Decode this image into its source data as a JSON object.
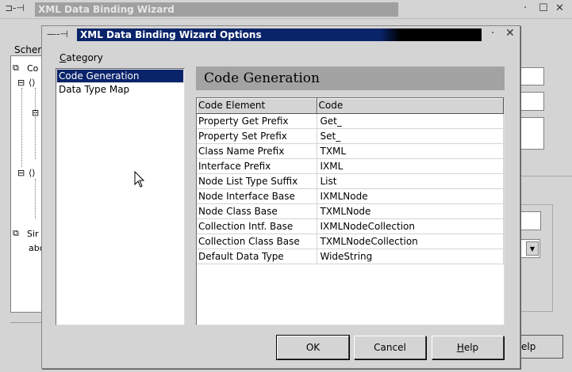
{
  "background_window": {
    "title": "XML Data Binding Wizard",
    "schema_label": "Scher",
    "tree_nodes": [
      "Co",
      "Sir"
    ],
    "help_button_label": "elp"
  },
  "dialog": {
    "title": "XML Data Binding Wizard Options",
    "category_label": "Category",
    "categories": [
      {
        "label": "Code Generation",
        "selected": true
      },
      {
        "label": "Data Type Map",
        "selected": false
      }
    ],
    "section_title": "Code Generation",
    "table": {
      "headers": [
        "Code Element",
        "Code"
      ],
      "rows": [
        [
          "Property Get Prefix",
          "Get_"
        ],
        [
          "Property Set Prefix",
          "Set_"
        ],
        [
          "Class Name Prefix",
          "TXML"
        ],
        [
          "Interface Prefix",
          "IXML"
        ],
        [
          "Node List Type Suffix",
          "List"
        ],
        [
          "Node Interface Base",
          "IXMLNode"
        ],
        [
          "Node Class Base",
          "TXMLNode"
        ],
        [
          "Collection Intf. Base",
          "IXMLNodeCollection"
        ],
        [
          "Collection Class Base",
          "TXMLNodeCollection"
        ],
        [
          "Default Data Type",
          "WideString"
        ]
      ]
    },
    "buttons": {
      "ok": "OK",
      "cancel": "Cancel",
      "help": "Help"
    }
  },
  "colors": {
    "title_active": "#0a246a",
    "selection": "#0a246a",
    "header_bg": "#a3a3a3",
    "face": "#d4d4d4"
  }
}
